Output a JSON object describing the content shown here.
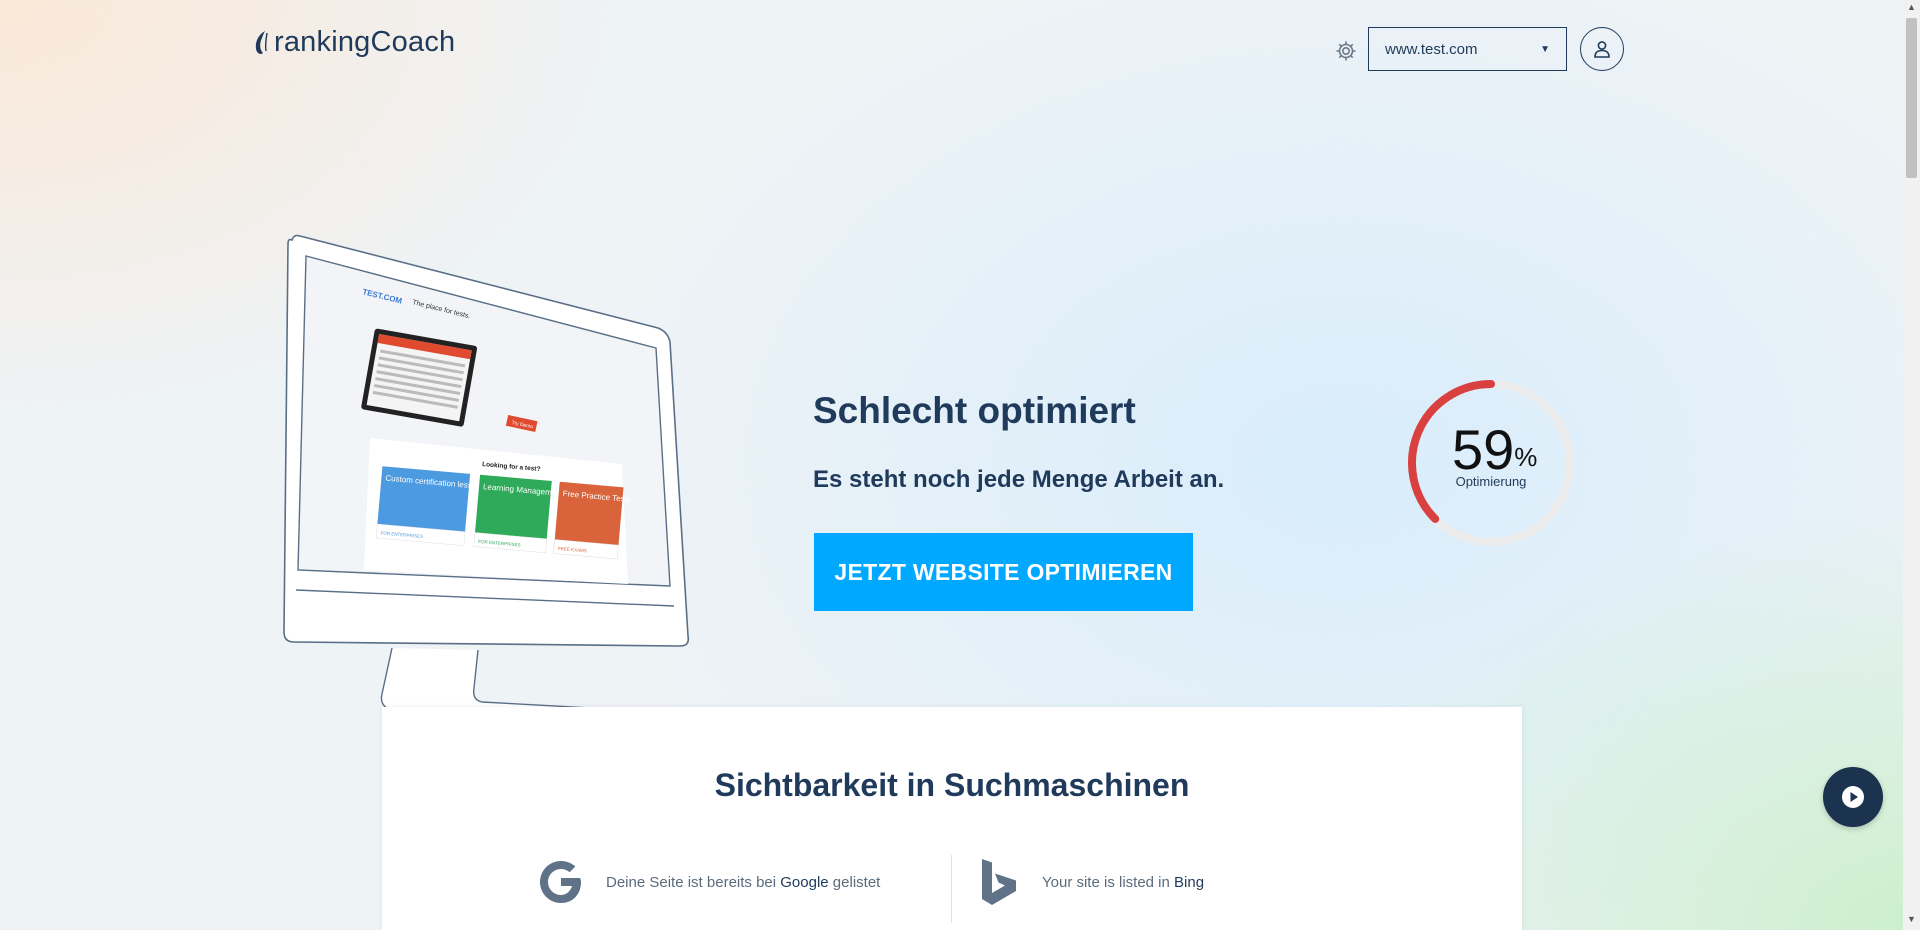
{
  "header": {
    "logo_text": "rankingCoach",
    "site_select_value": "www.test.com",
    "icons": {
      "settings": "gear-icon",
      "user": "user-icon",
      "dropdown": "caret-down-icon"
    }
  },
  "monitor": {
    "brand": "TEST.COM",
    "tagline": "The place for tests.",
    "button": "Try Demo",
    "section_title": "Looking for a test?",
    "tiles": [
      {
        "label": "Custom certification lesson and tests",
        "sub": "FOR ENTERPRISES",
        "color": "#4c9be0"
      },
      {
        "label": "Learning Management Systems",
        "sub": "FOR ENTERPRISES",
        "color": "#2eaa5a"
      },
      {
        "label": "Free Practice Tests",
        "sub": "FREE EXAMS",
        "color": "#d9643b"
      }
    ]
  },
  "hero": {
    "title": "Schlecht optimiert",
    "subtitle": "Es steht noch jede Menge Arbeit an.",
    "cta_label": "JETZT WEBSITE OPTIMIEREN"
  },
  "gauge": {
    "value": 59,
    "unit": "%",
    "label": "Optimierung",
    "color": "#d94040"
  },
  "visibility": {
    "title": "Sichtbarkeit in Suchmaschinen",
    "google": {
      "prefix": "Deine Seite ist bereits bei ",
      "engine": "Google",
      "suffix": " gelistet"
    },
    "bing": {
      "prefix": "Your site is listed in ",
      "engine": "Bing",
      "suffix": ""
    }
  },
  "colors": {
    "primary": "#1f3a5a",
    "accent": "#00a8ff",
    "danger": "#d94040"
  }
}
